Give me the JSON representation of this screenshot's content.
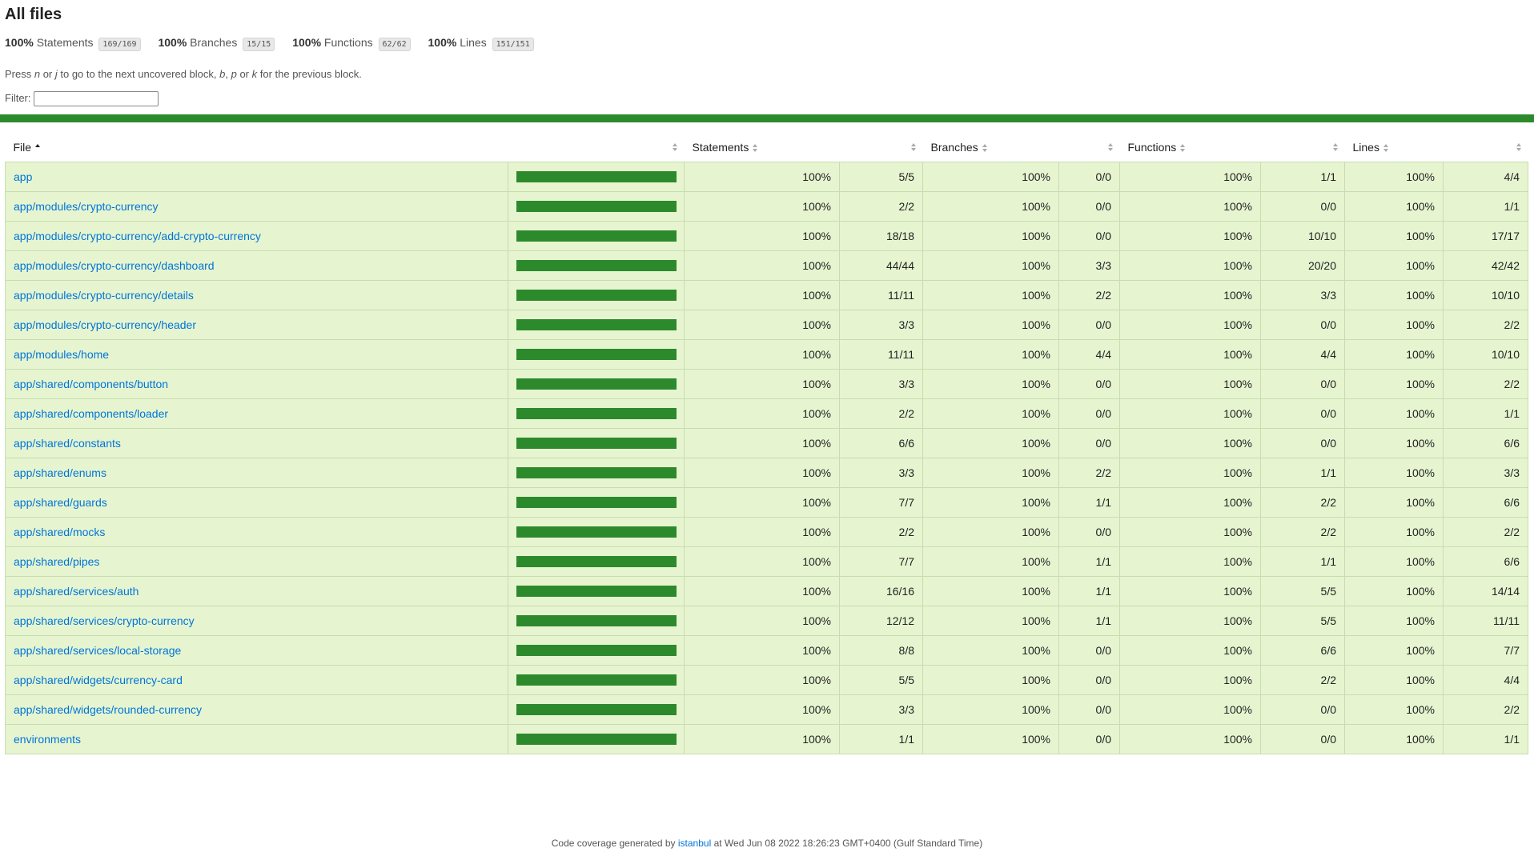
{
  "title": "All files",
  "summary": {
    "statements": {
      "pct": "100%",
      "label": "Statements",
      "fraction": "169/169"
    },
    "branches": {
      "pct": "100%",
      "label": "Branches",
      "fraction": "15/15"
    },
    "functions": {
      "pct": "100%",
      "label": "Functions",
      "fraction": "62/62"
    },
    "lines": {
      "pct": "100%",
      "label": "Lines",
      "fraction": "151/151"
    }
  },
  "hint": {
    "press": "Press ",
    "n": "n",
    "or1": " or ",
    "j": "j",
    "mid": " to go to the next uncovered block, ",
    "b": "b",
    "comma": ", ",
    "p": "p",
    "or2": " or ",
    "k": "k",
    "end": " for the previous block."
  },
  "filter": {
    "label": "Filter:",
    "value": ""
  },
  "headers": {
    "file": "File",
    "statements": "Statements",
    "branches": "Branches",
    "functions": "Functions",
    "lines": "Lines"
  },
  "colors": {
    "high": "#2c8a2c",
    "row_bg": "#e6f5d0",
    "link": "#0074d9"
  },
  "rows": [
    {
      "file": "app",
      "coverage": 1.0,
      "stmt_pct": "100%",
      "stmt": "5/5",
      "br_pct": "100%",
      "br": "0/0",
      "fn_pct": "100%",
      "fn": "1/1",
      "ln_pct": "100%",
      "ln": "4/4"
    },
    {
      "file": "app/modules/crypto-currency",
      "coverage": 1.0,
      "stmt_pct": "100%",
      "stmt": "2/2",
      "br_pct": "100%",
      "br": "0/0",
      "fn_pct": "100%",
      "fn": "0/0",
      "ln_pct": "100%",
      "ln": "1/1"
    },
    {
      "file": "app/modules/crypto-currency/add-crypto-currency",
      "coverage": 1.0,
      "stmt_pct": "100%",
      "stmt": "18/18",
      "br_pct": "100%",
      "br": "0/0",
      "fn_pct": "100%",
      "fn": "10/10",
      "ln_pct": "100%",
      "ln": "17/17"
    },
    {
      "file": "app/modules/crypto-currency/dashboard",
      "coverage": 1.0,
      "stmt_pct": "100%",
      "stmt": "44/44",
      "br_pct": "100%",
      "br": "3/3",
      "fn_pct": "100%",
      "fn": "20/20",
      "ln_pct": "100%",
      "ln": "42/42"
    },
    {
      "file": "app/modules/crypto-currency/details",
      "coverage": 1.0,
      "stmt_pct": "100%",
      "stmt": "11/11",
      "br_pct": "100%",
      "br": "2/2",
      "fn_pct": "100%",
      "fn": "3/3",
      "ln_pct": "100%",
      "ln": "10/10"
    },
    {
      "file": "app/modules/crypto-currency/header",
      "coverage": 1.0,
      "stmt_pct": "100%",
      "stmt": "3/3",
      "br_pct": "100%",
      "br": "0/0",
      "fn_pct": "100%",
      "fn": "0/0",
      "ln_pct": "100%",
      "ln": "2/2"
    },
    {
      "file": "app/modules/home",
      "coverage": 1.0,
      "stmt_pct": "100%",
      "stmt": "11/11",
      "br_pct": "100%",
      "br": "4/4",
      "fn_pct": "100%",
      "fn": "4/4",
      "ln_pct": "100%",
      "ln": "10/10"
    },
    {
      "file": "app/shared/components/button",
      "coverage": 1.0,
      "stmt_pct": "100%",
      "stmt": "3/3",
      "br_pct": "100%",
      "br": "0/0",
      "fn_pct": "100%",
      "fn": "0/0",
      "ln_pct": "100%",
      "ln": "2/2"
    },
    {
      "file": "app/shared/components/loader",
      "coverage": 1.0,
      "stmt_pct": "100%",
      "stmt": "2/2",
      "br_pct": "100%",
      "br": "0/0",
      "fn_pct": "100%",
      "fn": "0/0",
      "ln_pct": "100%",
      "ln": "1/1"
    },
    {
      "file": "app/shared/constants",
      "coverage": 1.0,
      "stmt_pct": "100%",
      "stmt": "6/6",
      "br_pct": "100%",
      "br": "0/0",
      "fn_pct": "100%",
      "fn": "0/0",
      "ln_pct": "100%",
      "ln": "6/6"
    },
    {
      "file": "app/shared/enums",
      "coverage": 1.0,
      "stmt_pct": "100%",
      "stmt": "3/3",
      "br_pct": "100%",
      "br": "2/2",
      "fn_pct": "100%",
      "fn": "1/1",
      "ln_pct": "100%",
      "ln": "3/3"
    },
    {
      "file": "app/shared/guards",
      "coverage": 1.0,
      "stmt_pct": "100%",
      "stmt": "7/7",
      "br_pct": "100%",
      "br": "1/1",
      "fn_pct": "100%",
      "fn": "2/2",
      "ln_pct": "100%",
      "ln": "6/6"
    },
    {
      "file": "app/shared/mocks",
      "coverage": 1.0,
      "stmt_pct": "100%",
      "stmt": "2/2",
      "br_pct": "100%",
      "br": "0/0",
      "fn_pct": "100%",
      "fn": "2/2",
      "ln_pct": "100%",
      "ln": "2/2"
    },
    {
      "file": "app/shared/pipes",
      "coverage": 1.0,
      "stmt_pct": "100%",
      "stmt": "7/7",
      "br_pct": "100%",
      "br": "1/1",
      "fn_pct": "100%",
      "fn": "1/1",
      "ln_pct": "100%",
      "ln": "6/6"
    },
    {
      "file": "app/shared/services/auth",
      "coverage": 1.0,
      "stmt_pct": "100%",
      "stmt": "16/16",
      "br_pct": "100%",
      "br": "1/1",
      "fn_pct": "100%",
      "fn": "5/5",
      "ln_pct": "100%",
      "ln": "14/14"
    },
    {
      "file": "app/shared/services/crypto-currency",
      "coverage": 1.0,
      "stmt_pct": "100%",
      "stmt": "12/12",
      "br_pct": "100%",
      "br": "1/1",
      "fn_pct": "100%",
      "fn": "5/5",
      "ln_pct": "100%",
      "ln": "11/11"
    },
    {
      "file": "app/shared/services/local-storage",
      "coverage": 1.0,
      "stmt_pct": "100%",
      "stmt": "8/8",
      "br_pct": "100%",
      "br": "0/0",
      "fn_pct": "100%",
      "fn": "6/6",
      "ln_pct": "100%",
      "ln": "7/7"
    },
    {
      "file": "app/shared/widgets/currency-card",
      "coverage": 1.0,
      "stmt_pct": "100%",
      "stmt": "5/5",
      "br_pct": "100%",
      "br": "0/0",
      "fn_pct": "100%",
      "fn": "2/2",
      "ln_pct": "100%",
      "ln": "4/4"
    },
    {
      "file": "app/shared/widgets/rounded-currency",
      "coverage": 1.0,
      "stmt_pct": "100%",
      "stmt": "3/3",
      "br_pct": "100%",
      "br": "0/0",
      "fn_pct": "100%",
      "fn": "0/0",
      "ln_pct": "100%",
      "ln": "2/2"
    },
    {
      "file": "environments",
      "coverage": 1.0,
      "stmt_pct": "100%",
      "stmt": "1/1",
      "br_pct": "100%",
      "br": "0/0",
      "fn_pct": "100%",
      "fn": "0/0",
      "ln_pct": "100%",
      "ln": "1/1"
    }
  ],
  "footer": {
    "prefix": "Code coverage generated by ",
    "link": "istanbul",
    "suffix": " at Wed Jun 08 2022 18:26:23 GMT+0400 (Gulf Standard Time)"
  }
}
